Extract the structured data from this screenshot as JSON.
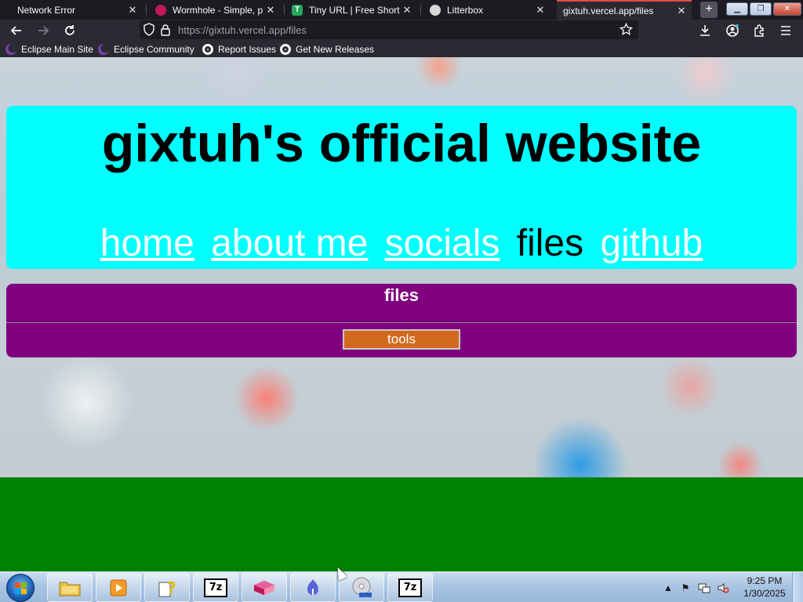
{
  "browser": {
    "tabs": [
      {
        "title": "Network Error",
        "favicon": "none",
        "active": false
      },
      {
        "title": "Wormhole - Simple, p",
        "favicon": "wormhole-icon",
        "active": false
      },
      {
        "title": "Tiny URL | Free Short L",
        "favicon": "tinyurl-icon",
        "favicon_text": "T",
        "active": false
      },
      {
        "title": "Litterbox",
        "favicon": "litterbox-icon",
        "active": false
      },
      {
        "title": "gixtuh.vercel.app/files",
        "favicon": "none",
        "active": true
      }
    ],
    "new_tab_label": "+",
    "url": {
      "host": "https://gixtuh.vercel.app",
      "path": "/files"
    },
    "bookmarks": [
      {
        "label": "Eclipse Main Site",
        "icon": "eclipse-icon"
      },
      {
        "label": "Eclipse Community",
        "icon": "eclipse-icon"
      },
      {
        "label": "Report Issues",
        "icon": "github-icon"
      },
      {
        "label": "Get New Releases",
        "icon": "github-icon"
      }
    ]
  },
  "site": {
    "title": "gixtuh's official website",
    "nav": [
      {
        "label": "home",
        "link": true
      },
      {
        "label": "about me",
        "link": true
      },
      {
        "label": "socials",
        "link": true
      },
      {
        "label": "files",
        "link": false
      },
      {
        "label": "github",
        "link": true
      }
    ],
    "files_section": {
      "heading": "files",
      "buttons": [
        {
          "label": "tools"
        }
      ]
    }
  },
  "taskbar": {
    "pinned": [
      {
        "name": "file-explorer-icon"
      },
      {
        "name": "media-player-icon"
      },
      {
        "name": "help-icon"
      },
      {
        "name": "7zip-icon",
        "text": "7z"
      },
      {
        "name": "vercel-icon"
      },
      {
        "name": "app-icon"
      },
      {
        "name": "disc-burner-icon"
      },
      {
        "name": "7zip-icon",
        "text": "7z"
      }
    ],
    "clock": {
      "time": "9:25 PM",
      "date": "1/30/2025"
    }
  },
  "colors": {
    "header_bg": "#00ffff",
    "files_panel_bg": "#800080",
    "tools_button_bg": "#d2691e",
    "footer_bg": "#008000",
    "active_tab_accent": "#e24a4a"
  }
}
